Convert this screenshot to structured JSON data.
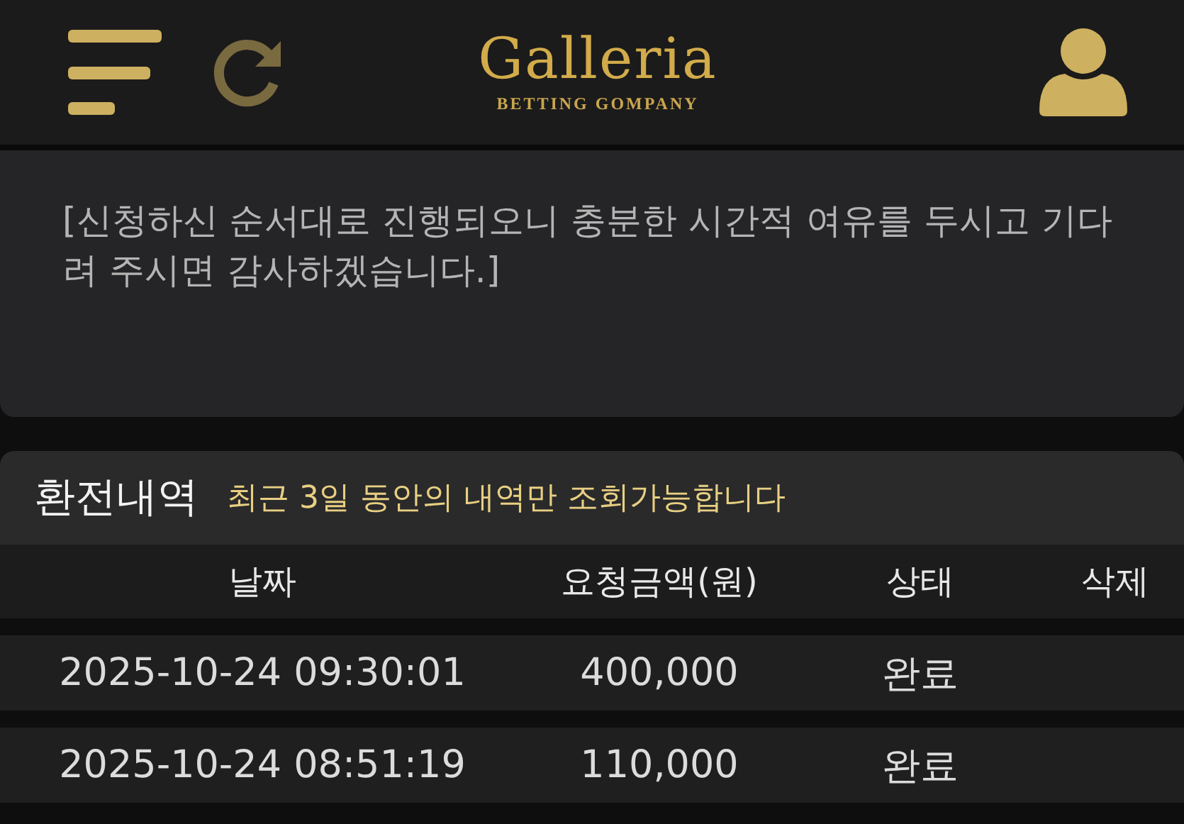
{
  "header": {
    "logo_title": "Galleria",
    "logo_subtitle": "BETTING GOMPANY"
  },
  "notice": {
    "text": "[신청하신 순서대로 진행되오니 충분한 시간적 여유를 두시고 기다려 주시면 감사하겠습니다.]"
  },
  "history": {
    "title": "환전내역",
    "note": "최근 3일 동안의 내역만 조회가능합니다",
    "columns": [
      "날짜",
      "요청금액(원)",
      "상태",
      "삭제"
    ],
    "rows": [
      {
        "date": "2025-10-24 09:30:01",
        "amount": "400,000",
        "status": "완료"
      },
      {
        "date": "2025-10-24 08:51:19",
        "amount": "110,000",
        "status": "완료"
      }
    ]
  }
}
